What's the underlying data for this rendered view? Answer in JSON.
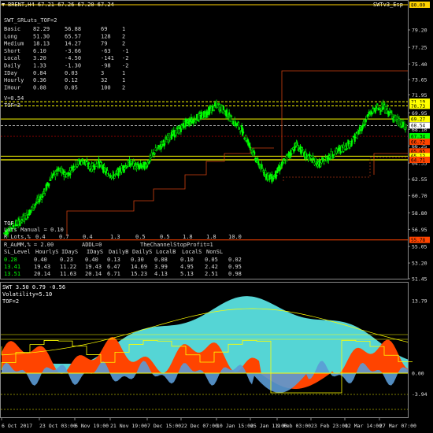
{
  "window": {
    "symbol_line": "BRENT,H4  67.21 67.26 67.20 67.24",
    "indicator_name": "SWTv3_Esp",
    "corner_marks": "▼"
  },
  "price_axis": {
    "labels": [
      "79.20",
      "77.25",
      "75.40",
      "73.65",
      "71.95",
      "69.95",
      "68.10",
      "66.25",
      "64.35",
      "62.55",
      "60.70",
      "58.80",
      "56.95",
      "55.05",
      "53.20",
      "51.45"
    ],
    "values": [
      79.2,
      77.25,
      75.4,
      73.65,
      71.95,
      69.95,
      68.1,
      66.25,
      64.35,
      62.55,
      60.7,
      58.8,
      56.95,
      55.05,
      53.2,
      51.45
    ],
    "tags": [
      {
        "text": "80.00",
        "value": 80.0,
        "bg": "#ffd200"
      },
      {
        "text": "71.19",
        "value": 71.19,
        "bg": "#ffff00"
      },
      {
        "text": "70.73",
        "value": 70.73,
        "bg": "#ffff00"
      },
      {
        "text": "69.27",
        "value": 69.27,
        "bg": "#ffff00"
      },
      {
        "text": "68.54",
        "value": 68.54,
        "bg": "#ffffff"
      },
      {
        "text": "67.34",
        "value": 67.34,
        "bg": "#00ff00"
      },
      {
        "text": "66.72",
        "value": 66.72,
        "bg": "#ff4400"
      },
      {
        "text": "65.65",
        "value": 65.65,
        "bg": "#ff4400"
      },
      {
        "text": "65.12",
        "value": 65.12,
        "bg": "#ffff00"
      },
      {
        "text": "64.71",
        "value": 64.71,
        "bg": "#ff4400"
      },
      {
        "text": "55.78",
        "value": 55.78,
        "bg": "#ff4400"
      }
    ]
  },
  "sub_axis": {
    "labels": [
      "13.79",
      "0.00",
      "-3.94"
    ],
    "values": [
      13.79,
      0.0,
      -3.94
    ]
  },
  "time_axis": {
    "labels": [
      "6 Oct 2017",
      "23 Oct 03:00",
      "6 Nov 19:00",
      "21 Nov 19:00",
      "7 Dec 15:00",
      "22 Dec 07:00",
      "10 Jan 15:00",
      "25 Jan 11:00",
      "9 Feb 03:00",
      "23 Feb 23:00",
      "12 Mar 14:00",
      "27 Mar 07:00"
    ]
  },
  "info_panel": {
    "header": "SWT_SRLuts_TOF=2",
    "rows": [
      [
        "Basic",
        "82.29",
        "56.88",
        "69",
        "1"
      ],
      [
        "Long",
        "51.30",
        "65.57",
        "128",
        "2"
      ],
      [
        "Medium",
        "18.13",
        "14.27",
        "79",
        "2"
      ],
      [
        "Short",
        "6.10",
        "-3.66",
        "-63",
        "-1"
      ],
      [
        "Local",
        "3.20",
        "-4.50",
        "-141",
        "-2"
      ],
      [
        "Daily",
        "1.33",
        "-1.30",
        "-98",
        "-2"
      ],
      [
        "IDay",
        "0.84",
        "0.03",
        "3",
        "1"
      ],
      [
        "Hourly",
        "0.36",
        "0.12",
        "32",
        "1"
      ],
      [
        "IHour",
        "0.08",
        "0.05",
        "100",
        "2"
      ]
    ],
    "v_line": "V=0.54",
    "tof_line": "TOF=3"
  },
  "lower_panel": {
    "tof": "TOF",
    "lots_manual": "Lots Manual = 0.10",
    "r_lots_label": "R_Lots,%",
    "r_lots_values": [
      "0.4",
      "0.7",
      "0.4",
      "1.3",
      "0.5",
      "0.5",
      "1.8",
      "1.8",
      "10.0"
    ],
    "r_aumm": "R_AuMM,% = 2.00",
    "addl": "ADDL=0",
    "stop_profit": "TheChannelStopProfit=1",
    "table_headers": [
      "SL_Level",
      "HourlyS",
      "IDayS",
      "IDayS",
      "DailyB",
      "DailyS",
      "LocalB",
      "LocalS",
      "NonSL"
    ],
    "table_rows": [
      {
        "c": "#00ff00",
        "cells": [
          "0.28",
          "0.40",
          "0.23",
          "0.40",
          "0.13",
          "0.30",
          "0.08",
          "0.10",
          "0.05",
          "0.02"
        ]
      },
      {
        "c": "#00ff00",
        "cells": [
          "13.41",
          "19.43",
          "11.22",
          "19.43",
          "6.47",
          "14.69",
          "3.99",
          "4.95",
          "2.42",
          "0.95"
        ]
      },
      {
        "c": "#00ff00",
        "cells": [
          "13.51",
          "20.14",
          "11.63",
          "20.14",
          "6.71",
          "15.23",
          "4.13",
          "5.13",
          "2.51",
          "0.98"
        ]
      }
    ]
  },
  "sub_window": {
    "title": "SWT 3.50 0.79 -0.56",
    "volatility": "Volatility=5.10",
    "tof": "TOF=2"
  },
  "colors": {
    "background": "#000000",
    "candles": "#00ff00",
    "yellow": "#ffff00",
    "orange_red": "#ff4400",
    "cyan": "#55d5d5",
    "blue": "#5b9bd5",
    "border": "#888888"
  },
  "chart_data": {
    "type": "line",
    "series": [
      {
        "values": [
          56.5,
          57.2,
          57.8,
          58.6,
          59.8,
          60.9,
          62.8,
          63.5,
          63.0,
          64.2,
          64.6,
          63.8,
          64.4,
          63.3,
          62.9,
          63.8,
          64.4,
          63.9,
          64.1,
          65.5,
          66.4,
          67.3,
          67.9,
          68.8,
          69.2,
          69.6,
          70.2,
          70.8,
          70.1,
          69.0,
          68.2,
          66.5,
          64.6,
          63.2,
          62.6,
          63.9,
          65.2,
          66.4,
          65.3,
          64.8,
          64.2,
          65.0,
          65.6,
          66.1,
          66.7,
          67.9,
          69.5,
          70.4,
          70.6,
          69.8,
          68.9,
          68.1
        ]
      }
    ]
  }
}
